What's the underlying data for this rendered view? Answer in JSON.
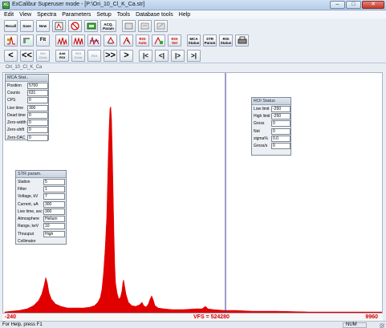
{
  "window": {
    "title": "ExCalibur Superuser mode - [P:\\Ori_10_Cl_K_Ca.str]"
  },
  "menu": [
    "Edit",
    "View",
    "Spectra",
    "Parameters",
    "Setup",
    "Tools",
    "Database tools",
    "Help"
  ],
  "toolbar1": [
    {
      "name": "recall-icon",
      "label": "Recall"
    },
    {
      "name": "save-icon",
      "label": "Save"
    },
    {
      "name": "new-icon",
      "label": "New"
    },
    {
      "name": "mca-settings-icon",
      "label": ""
    },
    {
      "name": "stop-icon",
      "label": ""
    },
    {
      "name": "acquire-icon",
      "label": ""
    },
    {
      "name": "acq-param-icon",
      "label": "ACQ. Param"
    },
    {
      "name": "calibration-icon",
      "label": ""
    },
    {
      "name": "hv-icon",
      "label": ""
    },
    {
      "name": "xray-icon",
      "label": ""
    }
  ],
  "toolbar2": [
    {
      "name": "peak-icon",
      "label": ""
    },
    {
      "name": "overlay-icon",
      "label": ""
    },
    {
      "name": "fit-icon",
      "label": "Fit"
    },
    {
      "name": "fit-spectrum-icon",
      "label": ""
    },
    {
      "name": "sum-spectrum-icon",
      "label": ""
    },
    {
      "name": "compare-spectrum-icon",
      "label": ""
    },
    {
      "name": "rotate-icon",
      "label": ""
    },
    {
      "name": "select-icon",
      "label": ""
    },
    {
      "name": "roi-auto-icon",
      "label": "ROI Auto"
    },
    {
      "name": "roi-set-icon",
      "label": ""
    },
    {
      "name": "roi-set2-icon",
      "label": "ROI Set"
    },
    {
      "name": "mca-status-icon",
      "label": "MCA Status"
    },
    {
      "name": "str-param-icon",
      "label": "STR Param"
    },
    {
      "name": "roi-status-icon",
      "label": "ROI Status"
    },
    {
      "name": "print-icon",
      "label": ""
    }
  ],
  "toolbar3": [
    {
      "name": "prev-spectrum-button",
      "label": "<"
    },
    {
      "name": "first-spectrum-button",
      "label": "<<"
    },
    {
      "name": "roi-clear-button",
      "label": "Roi Clear"
    },
    {
      "name": "add-roi-button",
      "label": "Add ROI"
    },
    {
      "name": "roi-clear2-button",
      "label": "ROI Clear"
    },
    {
      "name": "roi-prev-button",
      "label": "ROI"
    },
    {
      "name": "last-spectrum-button",
      "label": ">>"
    },
    {
      "name": "next-spectrum-button",
      "label": ">"
    },
    {
      "name": "zoom-start-button",
      "label": "|<"
    },
    {
      "name": "zoom-left-button",
      "label": "<|"
    },
    {
      "name": "zoom-right-button",
      "label": "|>"
    },
    {
      "name": "zoom-end-button",
      "label": ">|"
    }
  ],
  "document": {
    "tab": "Ori_10_Cl_K_Ca"
  },
  "mca_status": {
    "title": "MCA Stat..",
    "rows": [
      {
        "label": "Position",
        "value": "5700"
      },
      {
        "label": "Counts",
        "value": "631"
      },
      {
        "label": "CPS",
        "value": "0"
      },
      {
        "label": "Live time",
        "value": "300"
      },
      {
        "label": "Dead time",
        "value": "0"
      },
      {
        "label": "Zero-width",
        "value": "0"
      },
      {
        "label": "Zero-shift",
        "value": "0"
      },
      {
        "label": "Zero-DAC",
        "value": "0"
      }
    ]
  },
  "roi_status": {
    "title": "ROI Status",
    "rows": [
      {
        "label": "Low limit",
        "value": "-250"
      },
      {
        "label": "High limit",
        "value": "-250"
      },
      {
        "label": "Gross",
        "value": "0"
      },
      {
        "label": "Net",
        "value": "0"
      },
      {
        "label": "sigma%",
        "value": "0.0"
      },
      {
        "label": "Gross/s",
        "value": "0"
      }
    ]
  },
  "str_param": {
    "title": "STR param.",
    "rows": [
      {
        "label": "Station",
        "value": "5"
      },
      {
        "label": "Filter",
        "value": "1"
      },
      {
        "label": "Voltage, kV",
        "value": "7"
      },
      {
        "label": "Current, uA",
        "value": "300"
      },
      {
        "label": "Live time, sec",
        "value": "300"
      },
      {
        "label": "Atmosphere",
        "value": "Helium"
      },
      {
        "label": "Range, keV",
        "value": "10"
      },
      {
        "label": "Thruuput",
        "value": "High"
      },
      {
        "label": "Collimator",
        "value": ""
      }
    ]
  },
  "scale": {
    "left": "-240",
    "vfs": "VFS = 524280",
    "right": "9960"
  },
  "status": {
    "help": "For Help, press F1",
    "num": "NUM"
  },
  "colors": {
    "spectrum": "#e00000",
    "cursor": "#3a3a9a",
    "scale_text": "#d40000"
  }
}
